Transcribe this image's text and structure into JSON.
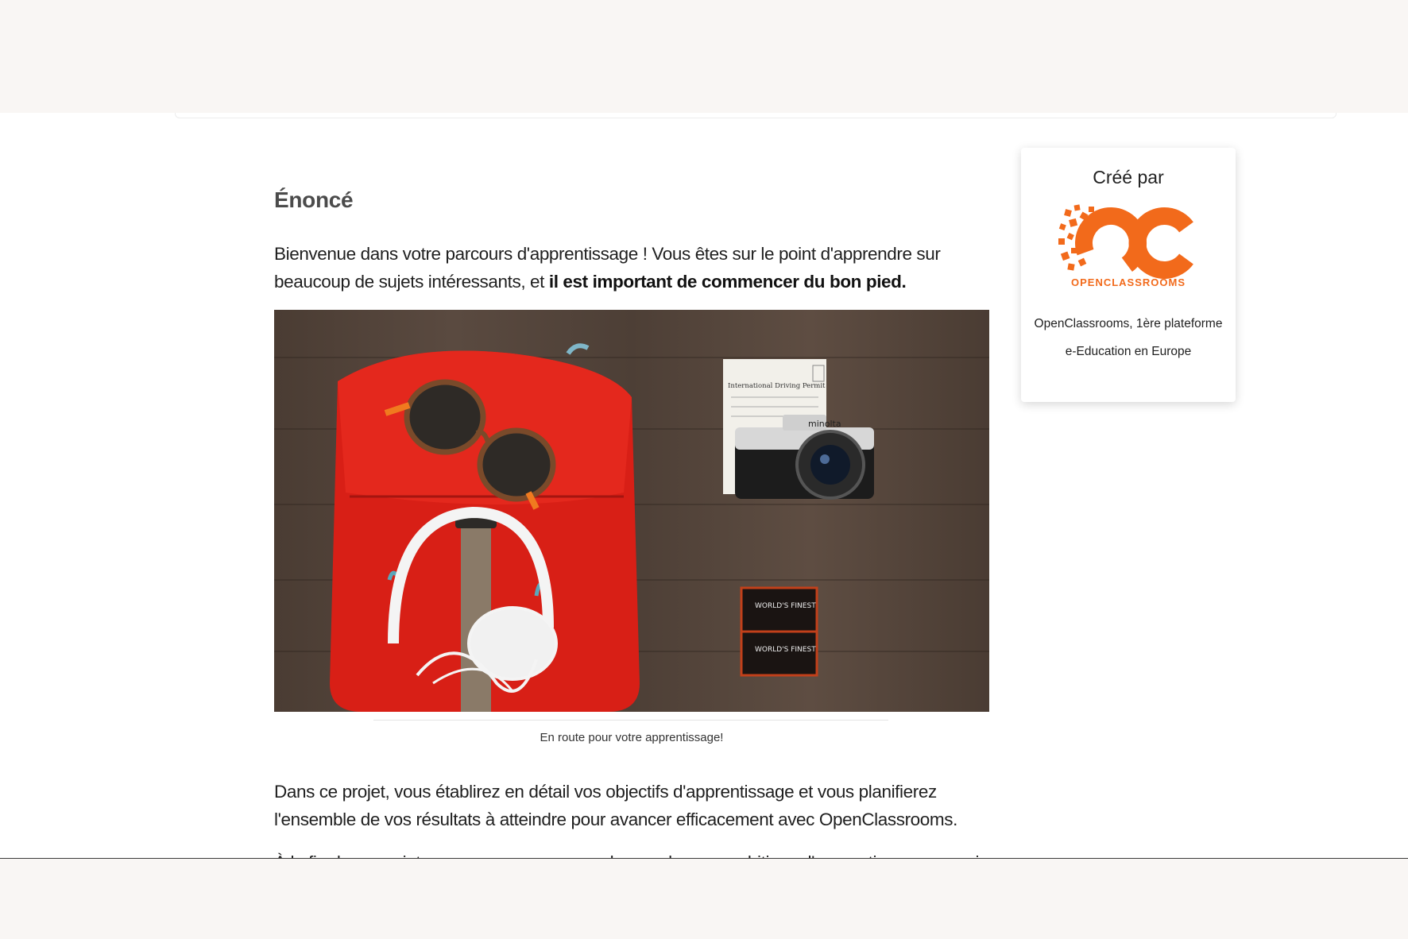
{
  "content": {
    "heading": "Énoncé",
    "intro_regular": "Bienvenue dans votre parcours d'apprentissage ! Vous êtes sur le point d'apprendre  sur beaucoup de sujets intéressants, et ",
    "intro_bold": "il est important de commencer du bon pied.",
    "image_caption": "En route pour votre apprentissage!",
    "paragraph_2": "Dans ce projet, vous établirez en détail vos objectifs d'apprentissage et vous planifierez l'ensemble de vos résultats à atteindre pour avancer efficacement avec OpenClassrooms.",
    "paragraph_3_partial": "À la fin de ce projet, vous serez en mesure de prendre vos ambitions d'apprentissage en main pour les mettre en"
  },
  "photo_text": {
    "permit": "International Driving Permit",
    "camera_brand": "minolta",
    "film_label": "WORLD'S FINEST"
  },
  "sidebar_card": {
    "title": "Créé par",
    "logo_letters": "OC",
    "logo_word": "OPENCLASSROOMS",
    "desc_line_1": "OpenClassrooms, 1ère plateforme",
    "desc_line_2": "e-Education en Europe"
  },
  "colors": {
    "brand_orange": "#f26a1b",
    "background": "#f9f6f4",
    "text": "#1f1f1f"
  }
}
